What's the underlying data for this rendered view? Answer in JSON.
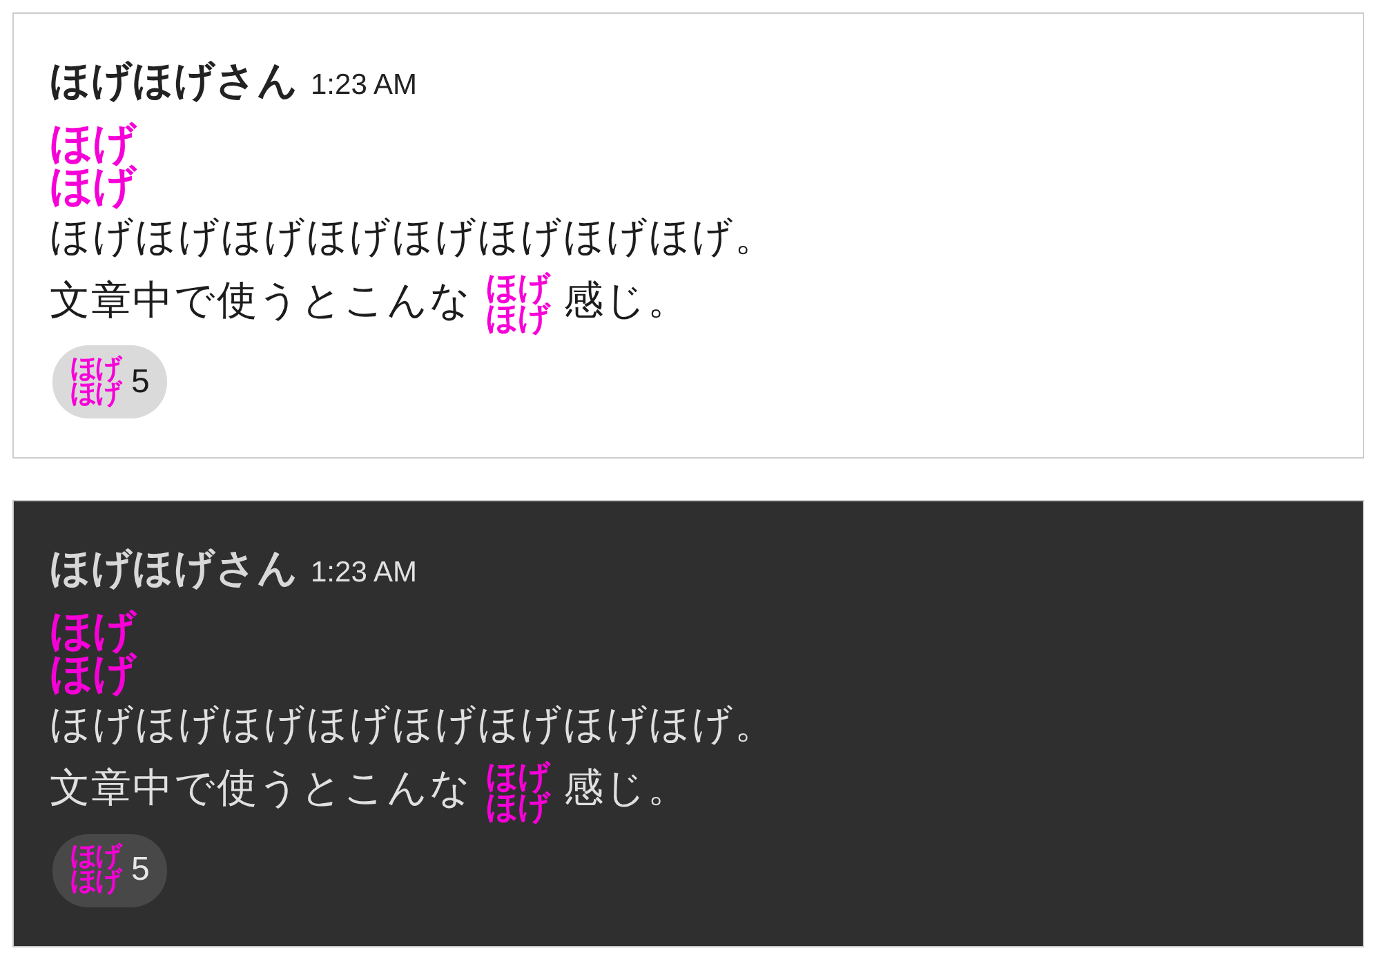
{
  "messages": [
    {
      "kind": "light",
      "author": "ほげほげさん",
      "time": "1:23 AM",
      "emoji": {
        "lines": [
          "ほげ",
          "ほげ"
        ]
      },
      "body": [
        [
          {
            "kind": "text",
            "text": "ほげほげほげほげほげほげほげほげ。"
          }
        ],
        [
          {
            "kind": "text",
            "text": "文章中で使うとこんな"
          },
          {
            "kind": "emoji",
            "lines": [
              "ほげ",
              "ほげ"
            ]
          },
          {
            "kind": "text",
            "text": "感じ。"
          }
        ]
      ],
      "reaction": {
        "emoji": {
          "lines": [
            "ほげ",
            "ほげ"
          ]
        },
        "count": "5"
      }
    },
    {
      "kind": "dark",
      "author": "ほげほげさん",
      "time": "1:23 AM",
      "emoji": {
        "lines": [
          "ほげ",
          "ほげ"
        ]
      },
      "body": [
        [
          {
            "kind": "text",
            "text": "ほげほげほげほげほげほげほげほげ。"
          }
        ],
        [
          {
            "kind": "text",
            "text": "文章中で使うとこんな"
          },
          {
            "kind": "emoji",
            "lines": [
              "ほげ",
              "ほげ"
            ]
          },
          {
            "kind": "text",
            "text": "感じ。"
          }
        ]
      ],
      "reaction": {
        "emoji": {
          "lines": [
            "ほげ",
            "ほげ"
          ]
        },
        "count": "5"
      }
    }
  ]
}
